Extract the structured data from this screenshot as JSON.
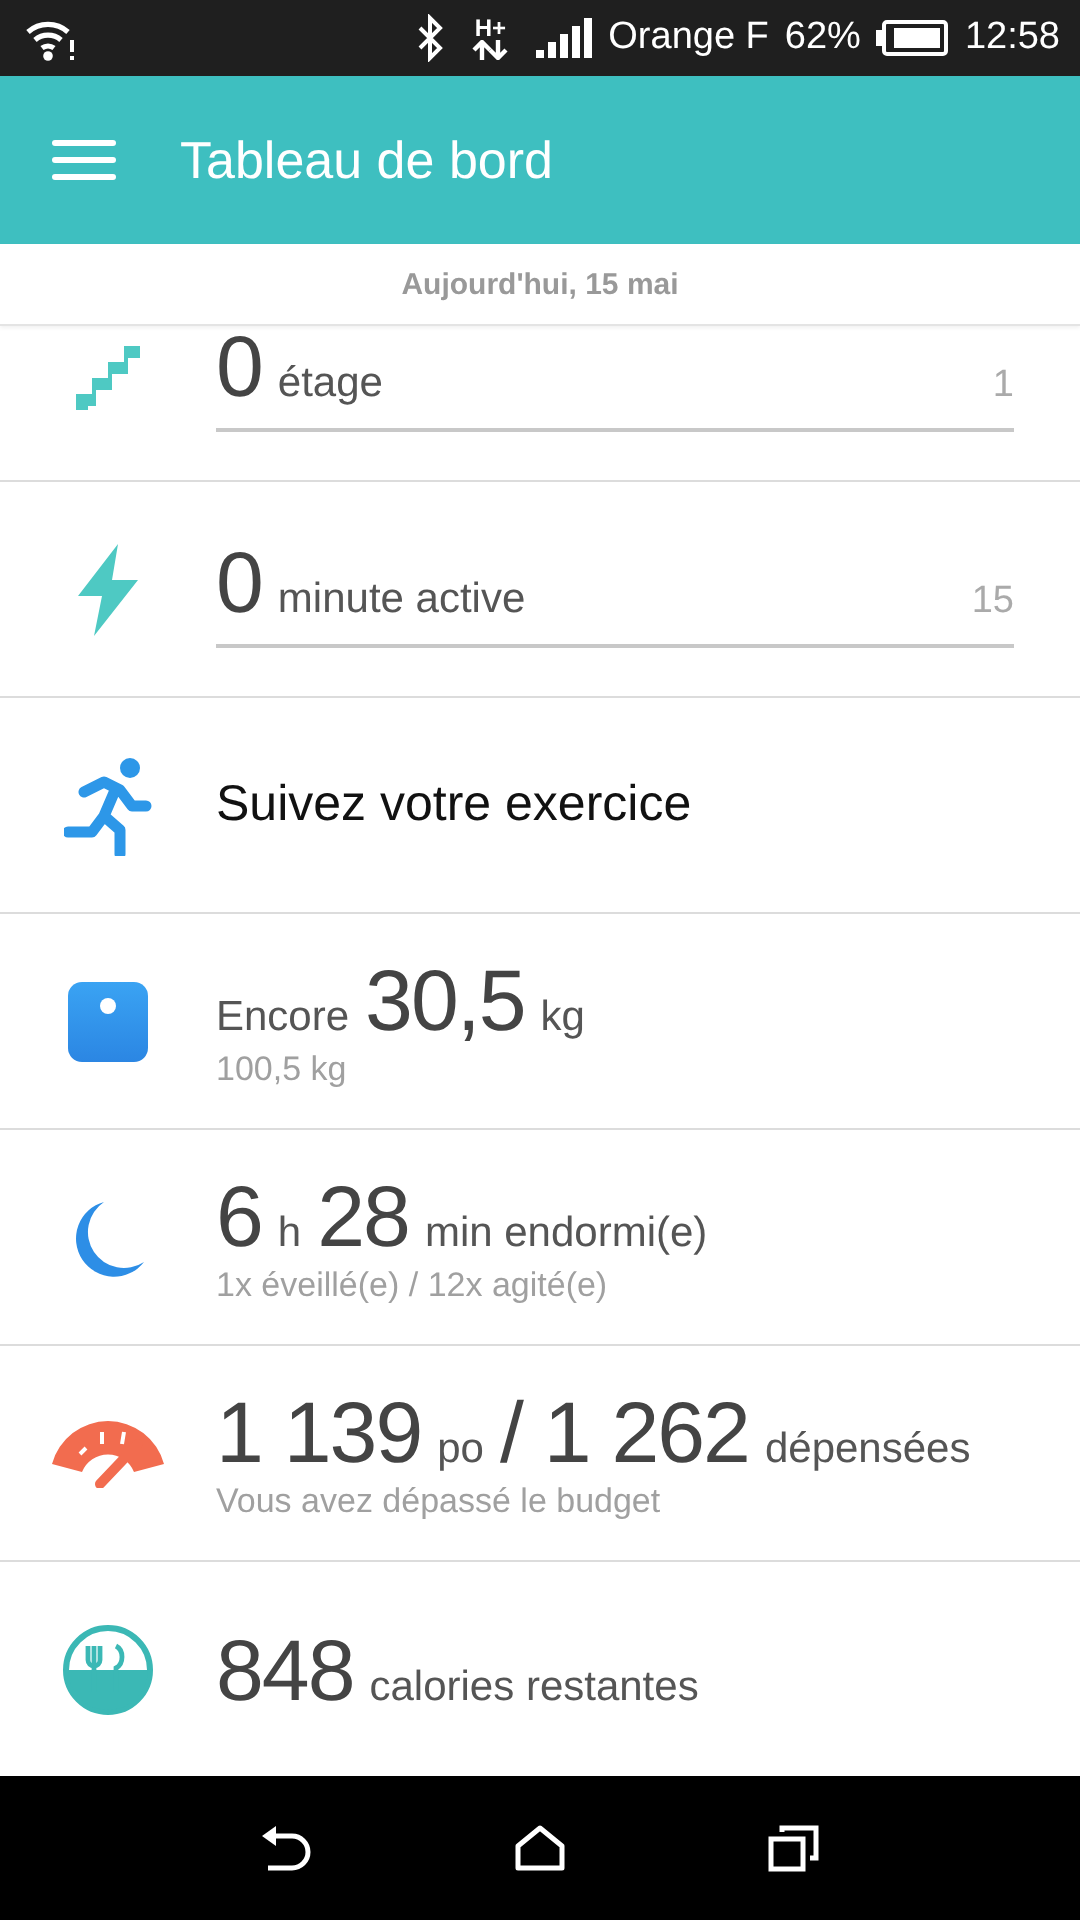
{
  "status_bar": {
    "network_type": "H+",
    "carrier": "Orange F",
    "battery": "62%",
    "time": "12:58"
  },
  "app_bar": {
    "title": "Tableau de bord"
  },
  "date_header": "Aujourd'hui, 15 mai",
  "rows": [
    {
      "kind": "floors",
      "parts": [
        {
          "number": "0"
        },
        {
          "unit": "étage"
        }
      ],
      "target": "1",
      "level": 0
    },
    {
      "kind": "activity",
      "parts": [
        {
          "number": "0"
        },
        {
          "unit": "minute active"
        }
      ],
      "target": "15",
      "level": 0
    },
    {
      "kind": "exercise",
      "label": "Suivez votre exercice"
    },
    {
      "kind": "weight",
      "parts": [
        {
          "unit": "Encore"
        },
        {
          "number": "30,5"
        },
        {
          "unit": "kg"
        }
      ],
      "subtitle": "100,5 kg"
    },
    {
      "kind": "sleep",
      "parts": [
        {
          "number": "6"
        },
        {
          "unit": "h"
        },
        {
          "number": "28"
        },
        {
          "unit": "min endormi(e)"
        }
      ],
      "subtitle": "1x éveillé(e) / 12x agité(e)"
    },
    {
      "kind": "calories",
      "parts": [
        {
          "number": "1 139"
        },
        {
          "unit": "po"
        },
        {
          "number": "/ 1 262"
        },
        {
          "unit": "dépensées"
        }
      ],
      "subtitle": "Vous avez dépassé le budget"
    },
    {
      "kind": "food",
      "parts": [
        {
          "number": "848"
        },
        {
          "unit": "calories restantes"
        }
      ]
    }
  ]
}
